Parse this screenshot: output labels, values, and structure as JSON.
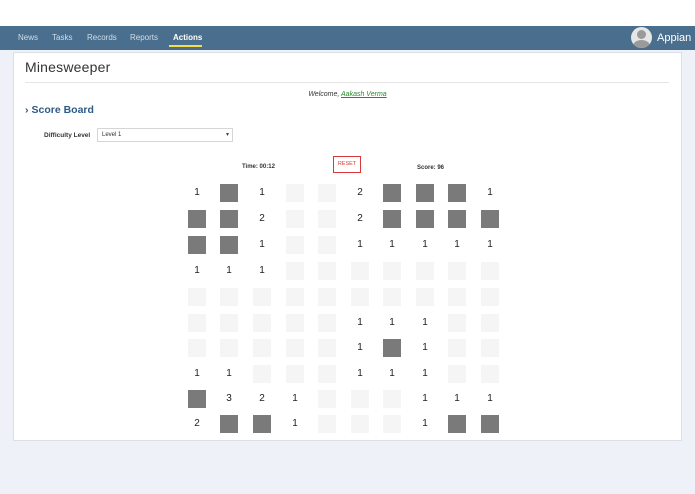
{
  "nav": {
    "items": [
      {
        "label": "News",
        "active": false
      },
      {
        "label": "Tasks",
        "active": false
      },
      {
        "label": "Records",
        "active": false
      },
      {
        "label": "Reports",
        "active": false
      },
      {
        "label": "Actions",
        "active": true
      }
    ],
    "brand": "Appian",
    "avatar_icon": "user-avatar-icon",
    "colors": {
      "bar": "#4a6f8e",
      "active_underline": "#f3df4a"
    }
  },
  "page": {
    "title": "Minesweeper",
    "welcome_prefix": "Welcome, ",
    "welcome_user": "Aakash Verma",
    "section_title": "Score Board",
    "section_icon": "chevron-right-icon"
  },
  "difficulty": {
    "label": "Difficulty Level",
    "selected": "Level 1"
  },
  "game": {
    "time_label": "Time: 00:12",
    "reset_label": "RESET",
    "score_label": "Score: 96",
    "board": [
      [
        "1",
        "#",
        "1",
        ".",
        ".",
        "2",
        "#",
        "#",
        "#",
        "1"
      ],
      [
        "#",
        "#",
        "2",
        ".",
        ".",
        "2",
        "#",
        "#",
        "#",
        "#"
      ],
      [
        "#",
        "#",
        "1",
        ".",
        ".",
        "1",
        "1",
        "1",
        "1",
        "1"
      ],
      [
        "1",
        "1",
        "1",
        ".",
        ".",
        ".",
        ".",
        ".",
        ".",
        "."
      ],
      [
        ".",
        ".",
        ".",
        ".",
        ".",
        ".",
        ".",
        ".",
        ".",
        "."
      ],
      [
        ".",
        ".",
        ".",
        ".",
        ".",
        "1",
        "1",
        "1",
        ".",
        "."
      ],
      [
        ".",
        ".",
        ".",
        ".",
        ".",
        "1",
        "#",
        "1",
        ".",
        "."
      ],
      [
        "1",
        "1",
        ".",
        ".",
        ".",
        "1",
        "1",
        "1",
        ".",
        "."
      ],
      [
        "#",
        "3",
        "2",
        "1",
        ".",
        ".",
        ".",
        "1",
        "1",
        "1"
      ],
      [
        "2",
        "#",
        "#",
        "1",
        ".",
        ".",
        ".",
        "1",
        "#",
        "#"
      ]
    ],
    "legend": {
      "#": "unrevealed",
      ".": "revealed-empty"
    },
    "colors": {
      "hidden": "#7a7a7a",
      "empty": "#f5f5f5",
      "reset_border": "#d9383a"
    }
  }
}
